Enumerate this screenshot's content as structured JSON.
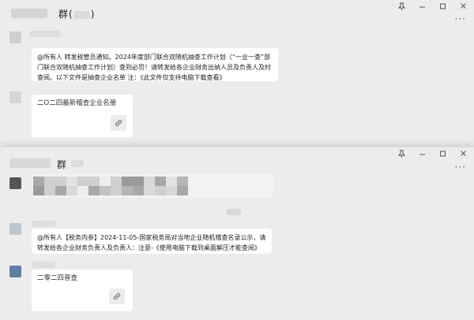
{
  "windows": [
    {
      "title": "群",
      "title_paren_open": "(",
      "title_paren_close": ")",
      "controls": [
        "pin-icon",
        "minimize-icon",
        "maximize-icon",
        "close-icon"
      ],
      "messages": [
        {
          "type": "text",
          "text": "@所有人 转发税管员通知。2024年度部门联合双随机抽查工作计划（“一业一查”部门联合双随机抽查工作计划）查到必罚！请转发给各企业财务出纳人员及负责人及时查阅。以下文件是抽查企业名单 注：《此文件仅支持电脑下载查看》"
        },
        {
          "type": "link",
          "title": "二O二四最新稽查企业名册"
        }
      ]
    },
    {
      "title": "群",
      "controls": [
        "pin-icon",
        "minimize-icon",
        "maximize-icon",
        "close-icon"
      ],
      "messages": [
        {
          "type": "image"
        },
        {
          "type": "text",
          "text": "@所有人【税务内参】2024-11-05-国家税务局对当地企业随机稽查名录公示，请转发给各企业财务负责人及负责人：注意-《使用电脑下载到桌面解压才能查阅》"
        },
        {
          "type": "link",
          "title": "二零二四普查"
        }
      ]
    }
  ],
  "colors": {
    "window_bg": "#ececec",
    "bubble_bg": "#ffffff",
    "text": "#222222"
  }
}
